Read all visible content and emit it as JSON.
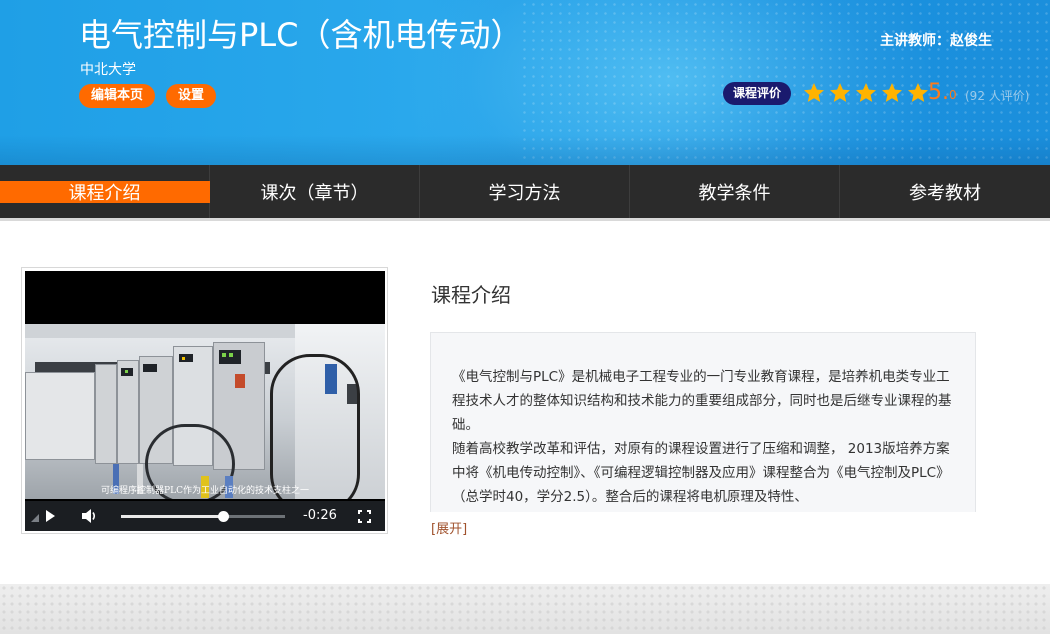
{
  "header": {
    "title": "电气控制与PLC（含机电传动）",
    "university": "中北大学",
    "edit_label": "编辑本页",
    "settings_label": "设置",
    "teacher": "主讲教师：赵俊生",
    "rating_label": "课程评价",
    "rating_value": 5.0,
    "score_main": "5.",
    "score_decimal": "0",
    "rating_count": "(92 人评价)",
    "star_color": "#ffb300"
  },
  "nav": {
    "items": [
      {
        "label": "课程介绍",
        "active": true
      },
      {
        "label": "课次（章节）",
        "active": false
      },
      {
        "label": "学习方法",
        "active": false
      },
      {
        "label": "教学条件",
        "active": false
      },
      {
        "label": "参考教材",
        "active": false
      }
    ],
    "active_color": "#ff6a00"
  },
  "video": {
    "subtitle": "可编程序控制器PLC作为工业自动化的技术支柱之一",
    "time_remaining": "-0:26",
    "progress": 0.62
  },
  "intro": {
    "heading": "课程介绍",
    "paragraph1": "《电气控制与PLC》是机械电子工程专业的一门专业教育课程，是培养机电类专业工程技术人才的整体知识结构和技术能力的重要组成部分，同时也是后继专业课程的基础。",
    "paragraph2": "随着高校教学改革和评估，对原有的课程设置进行了压缩和调整， 2013版培养方案中将《机电传动控制》、《可编程逻辑控制器及应用》课程整合为《电气控制及PLC》（总学时40，学分2.5）。整合后的课程将电机原理及特性、",
    "expand_label": "[展开]"
  }
}
